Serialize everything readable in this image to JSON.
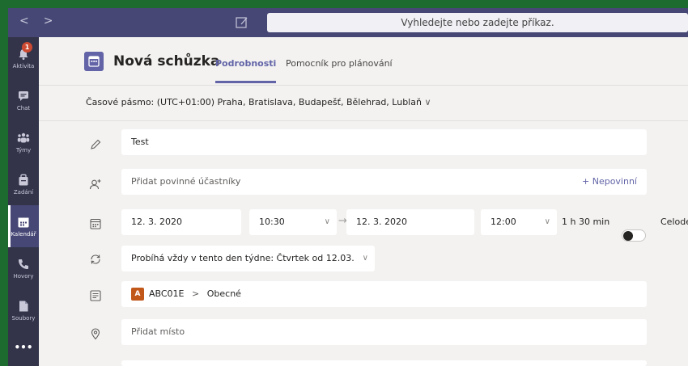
{
  "titlebar": {
    "search_placeholder": "Vyhledejte nebo zadejte příkaz."
  },
  "rail": {
    "activity": {
      "label": "Aktivita",
      "badge": "1"
    },
    "chat": {
      "label": "Chat"
    },
    "teams": {
      "label": "Týmy"
    },
    "assignments": {
      "label": "Zadání"
    },
    "calendar": {
      "label": "Kalendář"
    },
    "calls": {
      "label": "Hovory"
    },
    "files": {
      "label": "Soubory"
    },
    "more": {
      "label": "•••"
    }
  },
  "header": {
    "title": "Nová schůzka",
    "tabs": [
      {
        "label": "Podrobnosti"
      },
      {
        "label": "Pomocník pro plánování"
      }
    ]
  },
  "timezone": {
    "label": "Časové pásmo: (UTC+01:00) Praha, Bratislava, Budapešť, Bělehrad, Lublaň"
  },
  "form": {
    "title_value": "Test",
    "attendees_placeholder": "Přidat povinné účastníky",
    "optional_label": "+ Nepovinní",
    "start_date": "12. 3. 2020",
    "start_time": "10:30",
    "end_date": "12. 3. 2020",
    "end_time": "12:00",
    "duration": "1 h 30 min",
    "allday_label": "Celode",
    "recurrence": "Probíhá vždy v tento den týdne: Čtvrtek od 12.03.",
    "channel_badge": "A",
    "channel_team": "ABC01E",
    "channel_sep": ">",
    "channel_name": "Obecné",
    "location_placeholder": "Přidat místo"
  },
  "colors": {
    "brand": "#6264a7",
    "rail": "#33344a",
    "titlebar": "#464775",
    "badge": "#cc4a31",
    "channel": "#c2571a"
  }
}
